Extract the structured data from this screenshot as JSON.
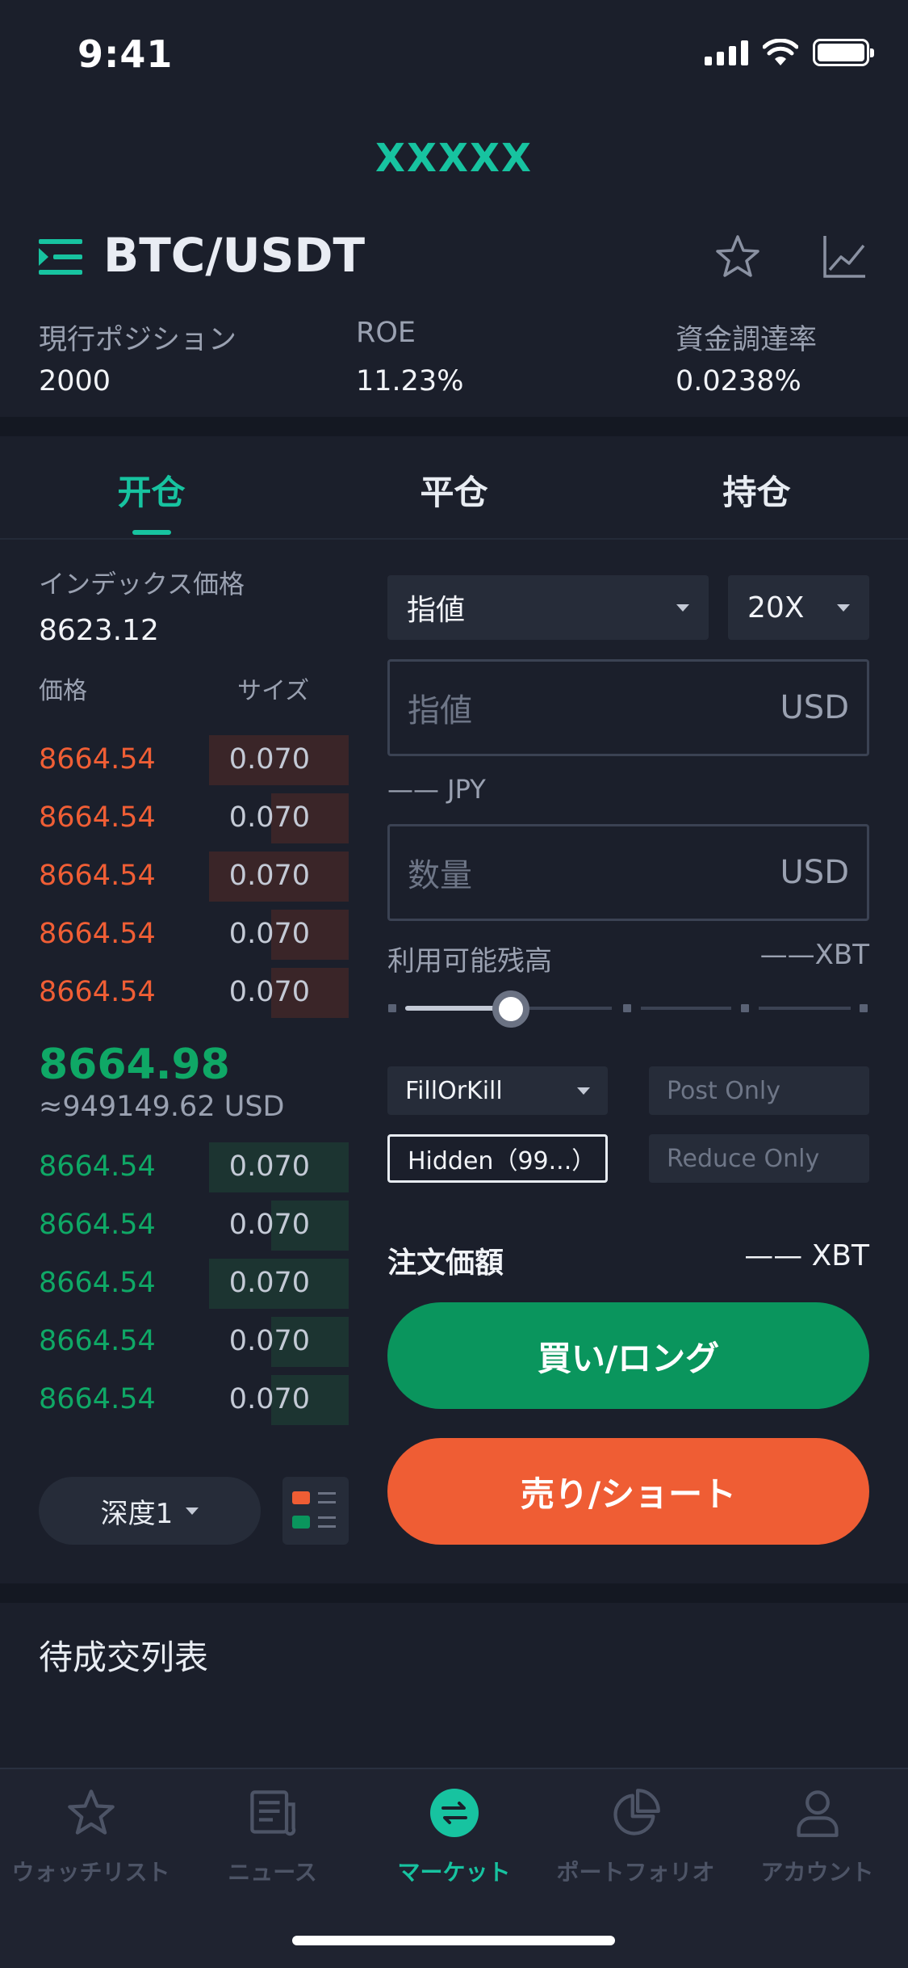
{
  "status_bar": {
    "time": "9:41"
  },
  "app": {
    "title": "XXXXX"
  },
  "pair": {
    "name": "BTC/USDT"
  },
  "stats": [
    {
      "label": "現行ポジション",
      "value": "2000"
    },
    {
      "label": "ROE",
      "value": "11.23%"
    },
    {
      "label": "資金調達率",
      "value": "0.0238%"
    }
  ],
  "tabs": [
    {
      "label": "开仓",
      "active": true
    },
    {
      "label": "平仓",
      "active": false
    },
    {
      "label": "持仓",
      "active": false
    }
  ],
  "order_book": {
    "index_label": "インデックス価格",
    "index_price": "8623.12",
    "price_header": "価格",
    "size_header": "サイズ",
    "asks": [
      {
        "price": "8664.54",
        "size": "0.070",
        "depth": 0.45
      },
      {
        "price": "8664.54",
        "size": "0.070",
        "depth": 0.25
      },
      {
        "price": "8664.54",
        "size": "0.070",
        "depth": 0.45
      },
      {
        "price": "8664.54",
        "size": "0.070",
        "depth": 0.25
      },
      {
        "price": "8664.54",
        "size": "0.070",
        "depth": 0.25
      }
    ],
    "last_price": "8664.98",
    "last_price_usd": "≈949149.62 USD",
    "bids": [
      {
        "price": "8664.54",
        "size": "0.070",
        "depth": 0.45
      },
      {
        "price": "8664.54",
        "size": "0.070",
        "depth": 0.25
      },
      {
        "price": "8664.54",
        "size": "0.070",
        "depth": 0.45
      },
      {
        "price": "8664.54",
        "size": "0.070",
        "depth": 0.25
      },
      {
        "price": "8664.54",
        "size": "0.070",
        "depth": 0.25
      }
    ],
    "depth_select": "深度1"
  },
  "order_form": {
    "order_type": "指値",
    "leverage": "20X",
    "price_placeholder": "指値",
    "price_unit": "USD",
    "jpy_label": "—— JPY",
    "qty_placeholder": "数量",
    "qty_unit": "USD",
    "available_label": "利用可能残高",
    "available_value": "——XBT",
    "slider_fraction": 0.2,
    "time_in_force": "FillOrKill",
    "post_only": "Post Only",
    "hidden": "Hidden（99...）",
    "reduce_only": "Reduce Only",
    "total_label": "注文価額",
    "total_value": "—— XBT",
    "buy_label": "買い/ロング",
    "sell_label": "売り/ショート"
  },
  "pending": {
    "title": "待成交列表"
  },
  "nav": [
    {
      "label": "ウォッチリスト",
      "icon": "star-icon",
      "active": false
    },
    {
      "label": "ニュース",
      "icon": "news-icon",
      "active": false
    },
    {
      "label": "マーケット",
      "icon": "exchange-icon",
      "active": true
    },
    {
      "label": "ポートフォリオ",
      "icon": "pie-chart-icon",
      "active": false
    },
    {
      "label": "アカウント",
      "icon": "user-icon",
      "active": false
    }
  ],
  "colors": {
    "accent": "#17c3a0",
    "buy": "#0a955d",
    "sell": "#ef5d34",
    "background": "#1b1f2b"
  }
}
